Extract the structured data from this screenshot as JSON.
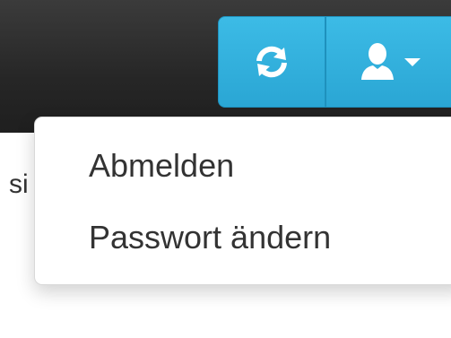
{
  "navbar": {
    "refresh_icon": "refresh-icon",
    "user_icon": "user-icon",
    "caret_icon": "caret-down-icon"
  },
  "page": {
    "partial_text": "si"
  },
  "user_menu": {
    "items": [
      {
        "label": "Abmelden"
      },
      {
        "label": "Passwort ändern"
      }
    ]
  },
  "colors": {
    "navbar_bg": "#262626",
    "button_bg": "#2aa6d4",
    "text": "#333333"
  }
}
